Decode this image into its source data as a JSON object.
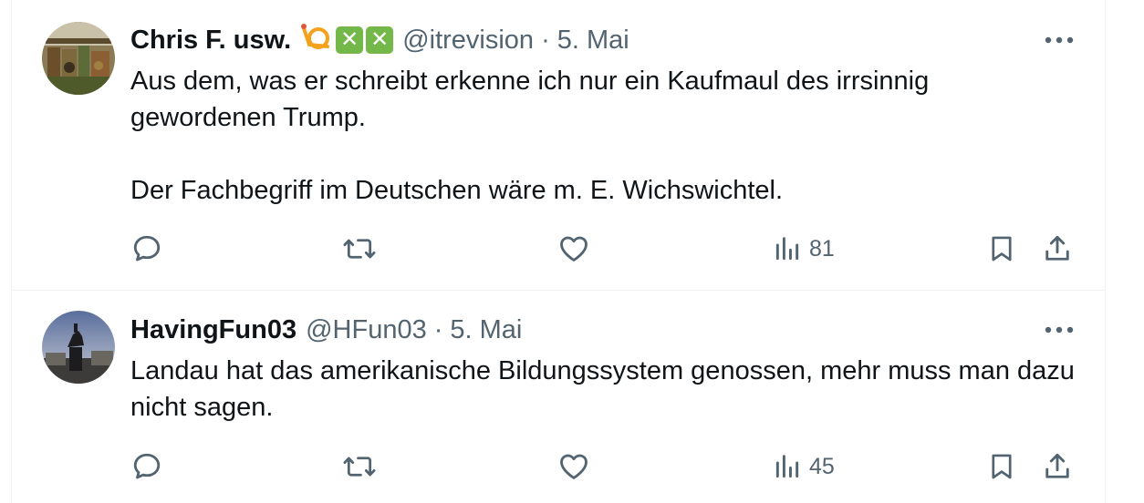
{
  "tweets": [
    {
      "name": "Chris F. usw.",
      "handle": "@itrevision",
      "separator": "·",
      "date": "5. Mai",
      "badges": [
        "posthorn-icon",
        "check-box-icon",
        "check-box-icon"
      ],
      "text": "Aus dem, was er schreibt erkenne ich nur ein Kaufmaul des irrsinnig gewordenen Trump.\n\nDer Fachbegriff im Deutschen wäre m. E. Wichswichtel.",
      "views": "81"
    },
    {
      "name": "HavingFun03",
      "handle": "@HFun03",
      "separator": "·",
      "date": "5. Mai",
      "text": "Landau hat das amerikanische Bildungssystem genossen, mehr muss man dazu nicht sagen.",
      "views": "45"
    }
  ],
  "colors": {
    "text": "#0f1419",
    "secondary": "#536471",
    "divider": "#eff3f4",
    "badge_green": "#75b84a",
    "posthorn": "#f4a21c"
  }
}
